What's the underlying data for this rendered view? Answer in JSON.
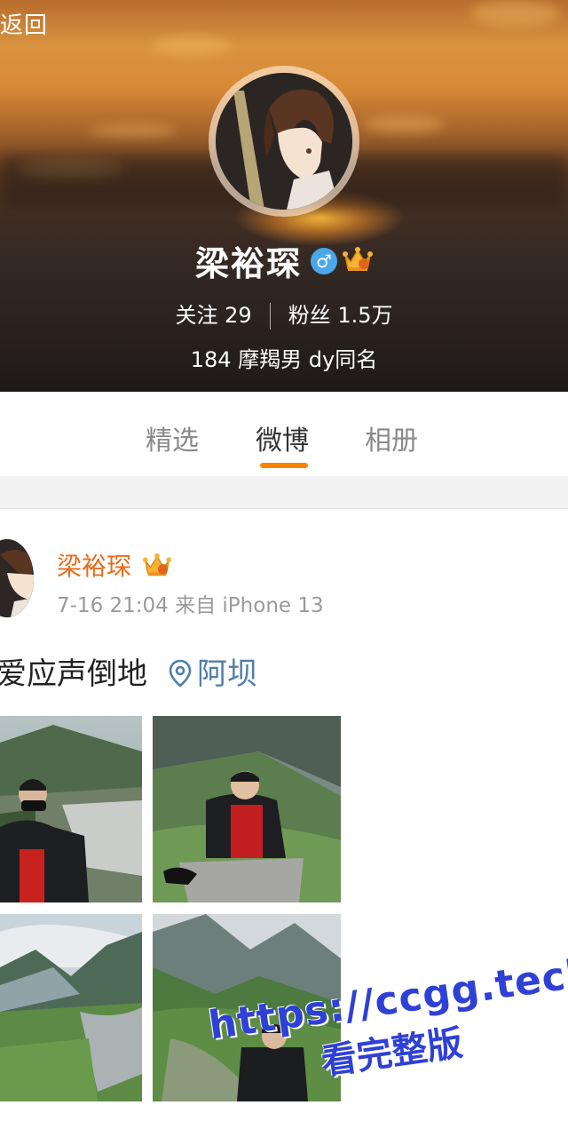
{
  "nav": {
    "back_label": "返回"
  },
  "profile": {
    "name": "梁裕琛",
    "gender_symbol": "♂",
    "gender_color": "#4aa7ea",
    "badge_icon": "vip-crown-icon",
    "following_label": "关注",
    "following_count": "29",
    "followers_label": "粉丝",
    "followers_count": "1.5万",
    "bio": "184 摩羯男 dy同名"
  },
  "tabs": [
    {
      "label": "精选",
      "active": false
    },
    {
      "label": "微博",
      "active": true
    },
    {
      "label": "相册",
      "active": false
    }
  ],
  "accent_color": "#ff8200",
  "post": {
    "author": "梁裕琛",
    "author_color": "#e86b1a",
    "meta": "7-16 21:04 来自 iPhone 13",
    "text": "爱应声倒地",
    "location_icon": "location-pin-icon",
    "location": "阿坝",
    "link_color": "#517ea9",
    "photos": [
      "photo-1",
      "photo-2",
      "photo-3",
      "photo-4"
    ]
  },
  "watermark": {
    "url": "https://ccgg.tech",
    "text": "看完整版"
  }
}
